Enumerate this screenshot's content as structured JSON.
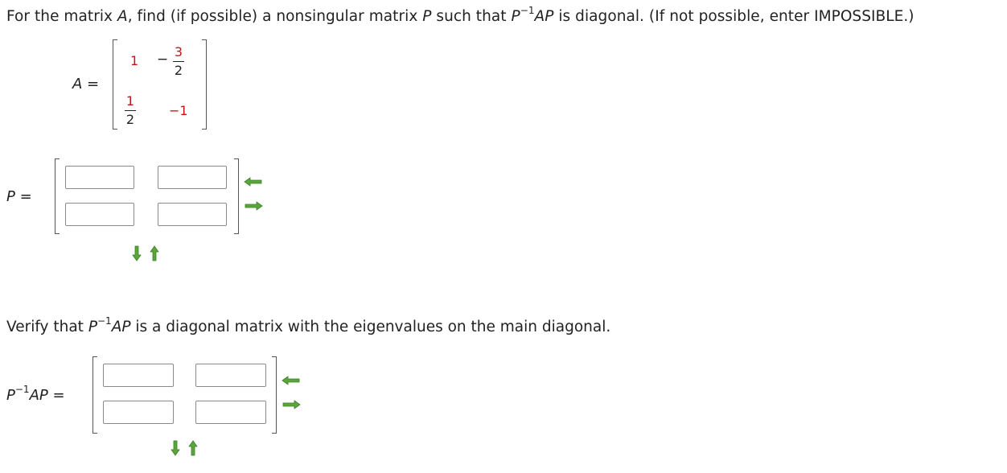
{
  "question": {
    "part1": "For the matrix ",
    "A": "A",
    "part2": ", find (if possible) a nonsingular matrix ",
    "P": "P",
    "part3": " such that ",
    "P2": "P",
    "sup": "−1",
    "AP": "AP",
    "part4": " is diagonal. (If not possible, enter IMPOSSIBLE.)"
  },
  "matrix_A": {
    "label": "A",
    "eq": " =",
    "a11": "1",
    "a12_sign": "−",
    "a12_num": "3",
    "a12_den": "2",
    "a21_num": "1",
    "a21_den": "2",
    "a22": "−1"
  },
  "matrix_P": {
    "label": "P",
    "eq": " =",
    "cells": [
      "",
      "",
      "",
      ""
    ]
  },
  "verify": {
    "part1": "Verify that ",
    "P": "P",
    "sup": "−1",
    "AP": "AP",
    "part2": " is a diagonal matrix with the eigenvalues on the main diagonal."
  },
  "matrix_D": {
    "label_P": "P",
    "label_sup": "−1",
    "label_AP": "AP",
    "eq": " =",
    "cells": [
      "",
      "",
      "",
      ""
    ]
  },
  "colors": {
    "entry_red": "#c0171b",
    "arrow_green": "#5aa63c"
  },
  "icons": [
    "remove-column-arrow-icon",
    "add-column-arrow-icon",
    "remove-row-arrow-icon",
    "add-row-arrow-icon"
  ]
}
